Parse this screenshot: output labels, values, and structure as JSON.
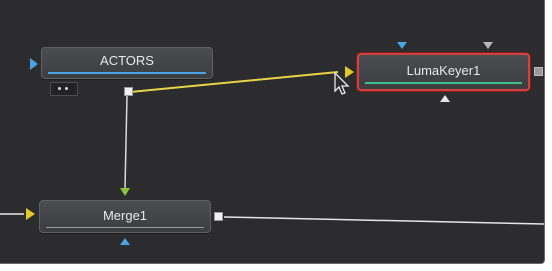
{
  "nodes": {
    "actors": {
      "label": "ACTORS"
    },
    "luma_keyer": {
      "label": "LumaKeyer1"
    },
    "merge": {
      "label": "Merge1"
    }
  },
  "colors": {
    "background": "#2c2c2e",
    "node_fill": "#45464a",
    "selected_border": "#d24040",
    "foreground_input": "#e3c926",
    "background_input": "#4aa3e6",
    "link_yellow": "#e8d24a",
    "link_white": "#d9d9d9",
    "link_green": "#8cc43a",
    "actors_bar": "#4aa3e6",
    "keyer_bar": "#3fbf8a"
  },
  "icons": [
    "triangle-input-icon",
    "output-port-icon",
    "mouse-cursor-icon",
    "node-options-icon"
  ]
}
